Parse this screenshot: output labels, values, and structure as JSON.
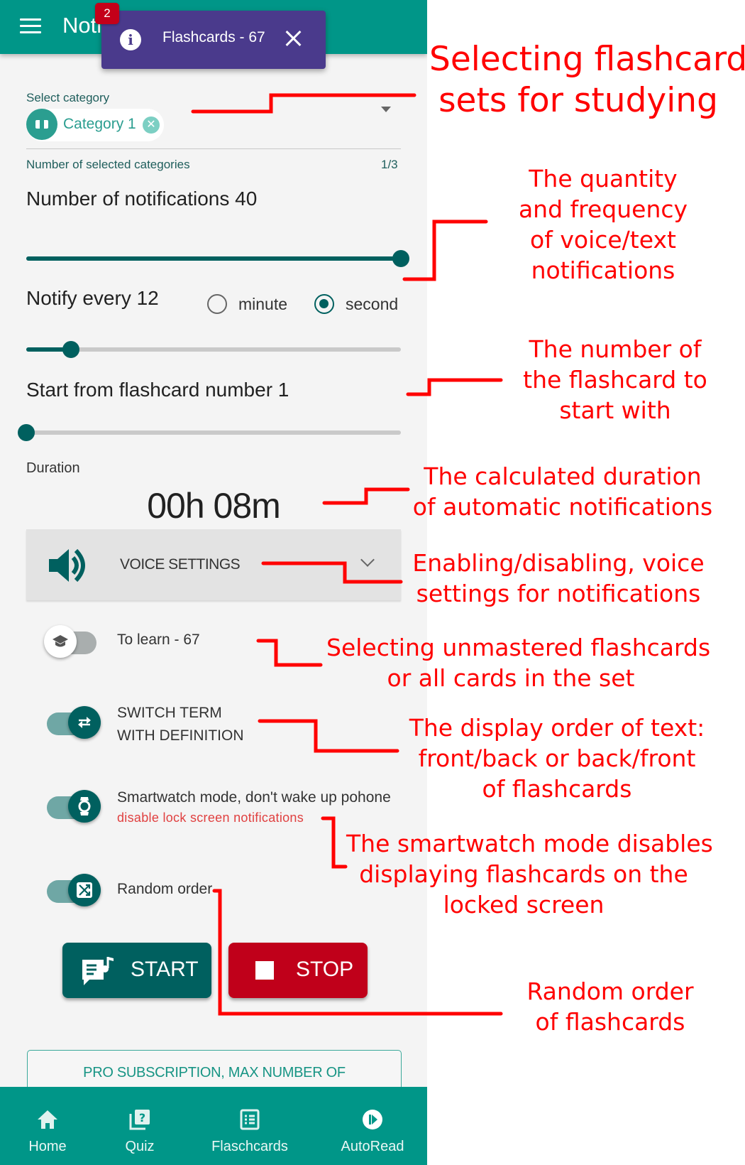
{
  "app": {
    "title": "Notifications",
    "notification_badge": "2",
    "toast": {
      "text": "Flashcards - 67",
      "icon": "info-icon"
    },
    "category": {
      "label": "Select category",
      "selected_chip": "Category 1",
      "count_label": "Number of selected categories",
      "count_value": "1/3"
    },
    "notifications": {
      "heading": "Number of notifications 40",
      "slider_fraction": 1.0
    },
    "frequency": {
      "heading": "Notify every 12",
      "unit_options": [
        "minute",
        "second"
      ],
      "selected_unit": "second",
      "slider_fraction": 0.12
    },
    "start_from": {
      "heading": "Start from flashcard number 1",
      "slider_fraction": 0.0
    },
    "duration": {
      "label": "Duration",
      "value": "00h 08m"
    },
    "voice_settings": {
      "label": "VOICE SETTINGS",
      "icon": "speaker-icon"
    },
    "toggles": [
      {
        "label": "To learn - 67",
        "icon": "graduation-cap-icon",
        "on": false
      },
      {
        "label_line1": "SWITCH TERM",
        "label_line2": "WITH DEFINITION",
        "icon": "swap-arrows-icon",
        "on": true
      },
      {
        "label": "Smartwatch mode, don't wake up pohone",
        "sublabel": "disable lock screen notifications",
        "icon": "smartwatch-icon",
        "on": true
      },
      {
        "label": "Random order",
        "icon": "shuffle-icon",
        "on": true
      }
    ],
    "buttons": {
      "start": "START",
      "stop": "STOP"
    },
    "pro_banner": "PRO SUBSCRIPTION, MAX NUMBER OF",
    "bottom_nav": [
      {
        "label": "Home",
        "icon": "home-icon"
      },
      {
        "label": "Quiz",
        "icon": "quiz-icon"
      },
      {
        "label": "Flaschcards",
        "icon": "list-icon"
      },
      {
        "label": "AutoRead",
        "icon": "autoread-play-icon"
      }
    ],
    "colors": {
      "primary": "#009688",
      "dark_teal": "#00605f",
      "toast": "#4a3a8c",
      "stop": "#c0001a",
      "badge": "#c40019"
    }
  },
  "annotations": {
    "title_line1": "Selecting flashcard",
    "title_line2": "sets for studying",
    "quantity": [
      "The quantity",
      "and frequency",
      "of voice/text",
      "notifications"
    ],
    "start_number": [
      "The number of",
      "the flashcard to",
      "start with"
    ],
    "duration": [
      "The calculated duration",
      "of automatic notifications"
    ],
    "voice": [
      "Enabling/disabling, voice",
      "settings for notifications"
    ],
    "unmastered": [
      "Selecting unmastered flashcards",
      "or all cards in the set"
    ],
    "display_order": [
      "The display order of text:",
      "front/back or back/front",
      "of flashcards"
    ],
    "smartwatch": [
      "The smartwatch mode disables",
      "displaying flashcards on the",
      "locked screen"
    ],
    "random": [
      "Random order",
      "of flashcards"
    ],
    "color": "#ff0000"
  }
}
